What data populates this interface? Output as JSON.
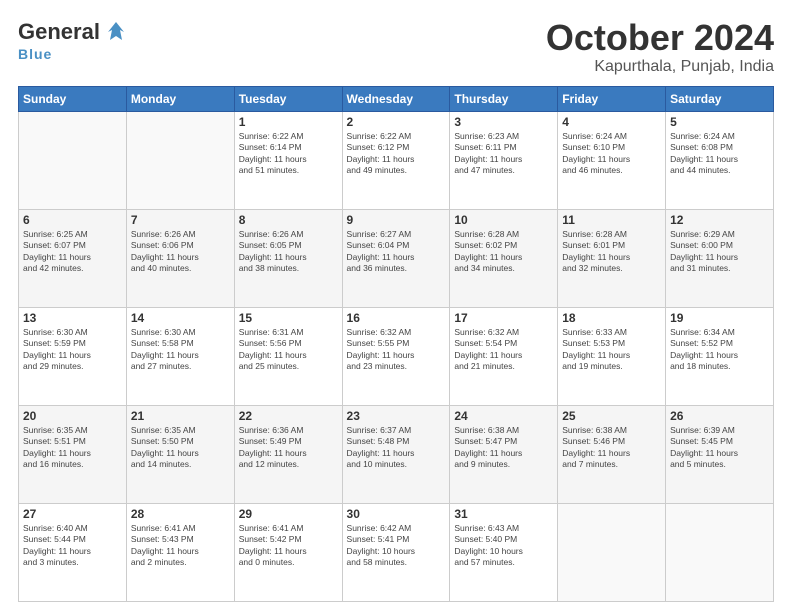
{
  "header": {
    "logo_general": "General",
    "logo_blue": "Blue",
    "month": "October 2024",
    "location": "Kapurthala, Punjab, India"
  },
  "days_of_week": [
    "Sunday",
    "Monday",
    "Tuesday",
    "Wednesday",
    "Thursday",
    "Friday",
    "Saturday"
  ],
  "weeks": [
    [
      {
        "day": "",
        "info": ""
      },
      {
        "day": "",
        "info": ""
      },
      {
        "day": "1",
        "info": "Sunrise: 6:22 AM\nSunset: 6:14 PM\nDaylight: 11 hours\nand 51 minutes."
      },
      {
        "day": "2",
        "info": "Sunrise: 6:22 AM\nSunset: 6:12 PM\nDaylight: 11 hours\nand 49 minutes."
      },
      {
        "day": "3",
        "info": "Sunrise: 6:23 AM\nSunset: 6:11 PM\nDaylight: 11 hours\nand 47 minutes."
      },
      {
        "day": "4",
        "info": "Sunrise: 6:24 AM\nSunset: 6:10 PM\nDaylight: 11 hours\nand 46 minutes."
      },
      {
        "day": "5",
        "info": "Sunrise: 6:24 AM\nSunset: 6:08 PM\nDaylight: 11 hours\nand 44 minutes."
      }
    ],
    [
      {
        "day": "6",
        "info": "Sunrise: 6:25 AM\nSunset: 6:07 PM\nDaylight: 11 hours\nand 42 minutes."
      },
      {
        "day": "7",
        "info": "Sunrise: 6:26 AM\nSunset: 6:06 PM\nDaylight: 11 hours\nand 40 minutes."
      },
      {
        "day": "8",
        "info": "Sunrise: 6:26 AM\nSunset: 6:05 PM\nDaylight: 11 hours\nand 38 minutes."
      },
      {
        "day": "9",
        "info": "Sunrise: 6:27 AM\nSunset: 6:04 PM\nDaylight: 11 hours\nand 36 minutes."
      },
      {
        "day": "10",
        "info": "Sunrise: 6:28 AM\nSunset: 6:02 PM\nDaylight: 11 hours\nand 34 minutes."
      },
      {
        "day": "11",
        "info": "Sunrise: 6:28 AM\nSunset: 6:01 PM\nDaylight: 11 hours\nand 32 minutes."
      },
      {
        "day": "12",
        "info": "Sunrise: 6:29 AM\nSunset: 6:00 PM\nDaylight: 11 hours\nand 31 minutes."
      }
    ],
    [
      {
        "day": "13",
        "info": "Sunrise: 6:30 AM\nSunset: 5:59 PM\nDaylight: 11 hours\nand 29 minutes."
      },
      {
        "day": "14",
        "info": "Sunrise: 6:30 AM\nSunset: 5:58 PM\nDaylight: 11 hours\nand 27 minutes."
      },
      {
        "day": "15",
        "info": "Sunrise: 6:31 AM\nSunset: 5:56 PM\nDaylight: 11 hours\nand 25 minutes."
      },
      {
        "day": "16",
        "info": "Sunrise: 6:32 AM\nSunset: 5:55 PM\nDaylight: 11 hours\nand 23 minutes."
      },
      {
        "day": "17",
        "info": "Sunrise: 6:32 AM\nSunset: 5:54 PM\nDaylight: 11 hours\nand 21 minutes."
      },
      {
        "day": "18",
        "info": "Sunrise: 6:33 AM\nSunset: 5:53 PM\nDaylight: 11 hours\nand 19 minutes."
      },
      {
        "day": "19",
        "info": "Sunrise: 6:34 AM\nSunset: 5:52 PM\nDaylight: 11 hours\nand 18 minutes."
      }
    ],
    [
      {
        "day": "20",
        "info": "Sunrise: 6:35 AM\nSunset: 5:51 PM\nDaylight: 11 hours\nand 16 minutes."
      },
      {
        "day": "21",
        "info": "Sunrise: 6:35 AM\nSunset: 5:50 PM\nDaylight: 11 hours\nand 14 minutes."
      },
      {
        "day": "22",
        "info": "Sunrise: 6:36 AM\nSunset: 5:49 PM\nDaylight: 11 hours\nand 12 minutes."
      },
      {
        "day": "23",
        "info": "Sunrise: 6:37 AM\nSunset: 5:48 PM\nDaylight: 11 hours\nand 10 minutes."
      },
      {
        "day": "24",
        "info": "Sunrise: 6:38 AM\nSunset: 5:47 PM\nDaylight: 11 hours\nand 9 minutes."
      },
      {
        "day": "25",
        "info": "Sunrise: 6:38 AM\nSunset: 5:46 PM\nDaylight: 11 hours\nand 7 minutes."
      },
      {
        "day": "26",
        "info": "Sunrise: 6:39 AM\nSunset: 5:45 PM\nDaylight: 11 hours\nand 5 minutes."
      }
    ],
    [
      {
        "day": "27",
        "info": "Sunrise: 6:40 AM\nSunset: 5:44 PM\nDaylight: 11 hours\nand 3 minutes."
      },
      {
        "day": "28",
        "info": "Sunrise: 6:41 AM\nSunset: 5:43 PM\nDaylight: 11 hours\nand 2 minutes."
      },
      {
        "day": "29",
        "info": "Sunrise: 6:41 AM\nSunset: 5:42 PM\nDaylight: 11 hours\nand 0 minutes."
      },
      {
        "day": "30",
        "info": "Sunrise: 6:42 AM\nSunset: 5:41 PM\nDaylight: 10 hours\nand 58 minutes."
      },
      {
        "day": "31",
        "info": "Sunrise: 6:43 AM\nSunset: 5:40 PM\nDaylight: 10 hours\nand 57 minutes."
      },
      {
        "day": "",
        "info": ""
      },
      {
        "day": "",
        "info": ""
      }
    ]
  ]
}
